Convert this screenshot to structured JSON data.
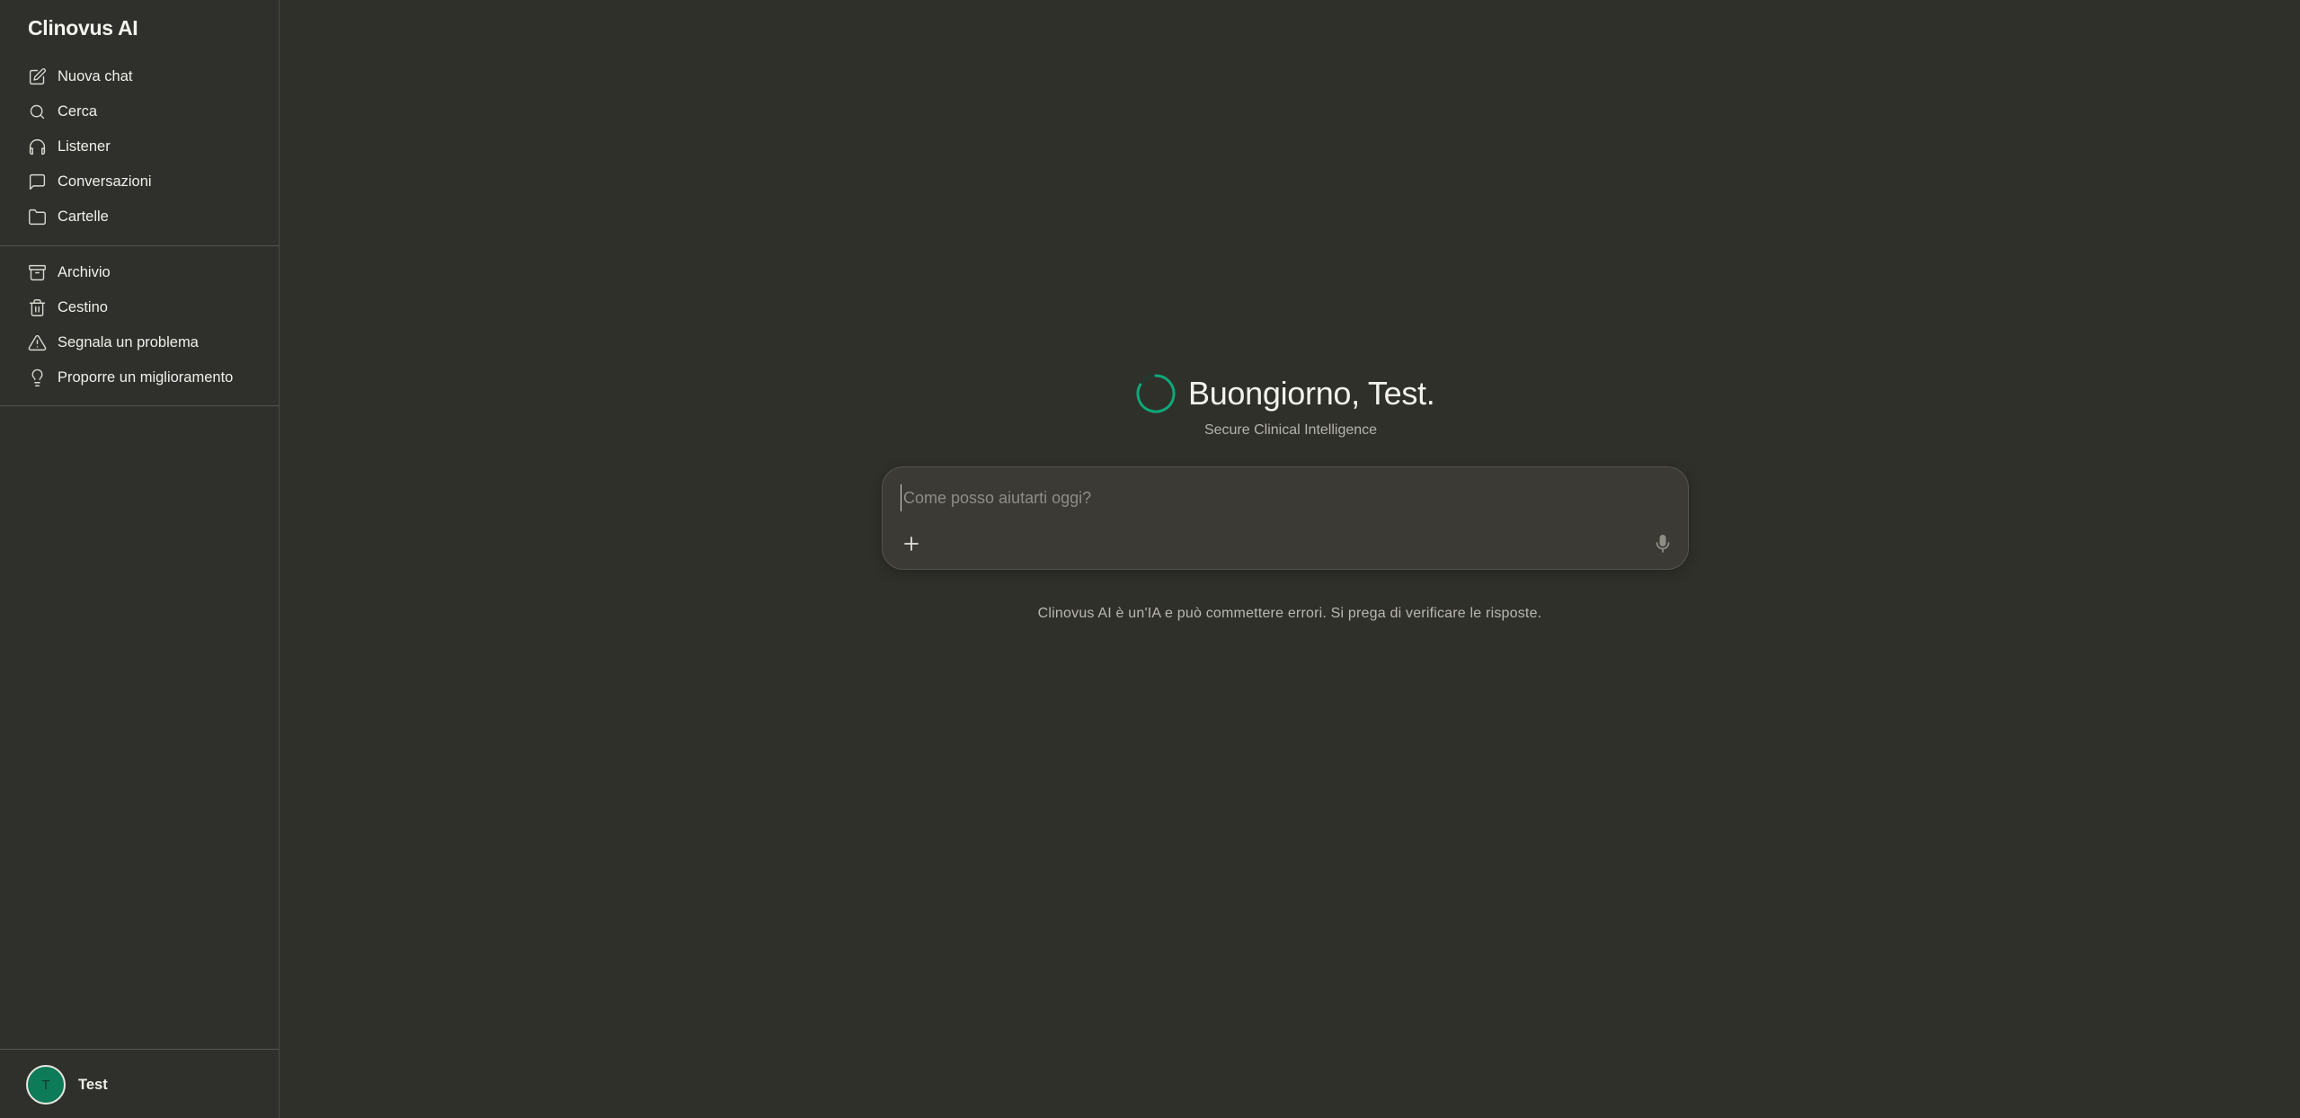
{
  "sidebar": {
    "brand": "Clinovus AI",
    "primary_items": [
      {
        "label": "Nuova chat",
        "icon": "edit-icon"
      },
      {
        "label": "Cerca",
        "icon": "search-icon"
      },
      {
        "label": "Listener",
        "icon": "headphones-icon"
      },
      {
        "label": "Conversazioni",
        "icon": "chat-bubble-icon"
      },
      {
        "label": "Cartelle",
        "icon": "folder-icon"
      }
    ],
    "secondary_items": [
      {
        "label": "Archivio",
        "icon": "archive-icon"
      },
      {
        "label": "Cestino",
        "icon": "trash-icon"
      },
      {
        "label": "Segnala un problema",
        "icon": "warning-icon"
      },
      {
        "label": "Proporre un miglioramento",
        "icon": "lightbulb-icon"
      }
    ],
    "user": {
      "initial": "T",
      "name": "Test"
    }
  },
  "main": {
    "greeting": "Buongiorno, Test.",
    "subtitle": "Secure Clinical Intelligence",
    "composer": {
      "placeholder": "Come posso aiutarti oggi?",
      "value": ""
    },
    "disclaimer": "Clinovus AI è un'IA e può commettere errori. Si prega di verificare le risposte."
  },
  "colors": {
    "background": "#30302b",
    "accent": "#0d7a58",
    "spinner": "#10a778"
  }
}
